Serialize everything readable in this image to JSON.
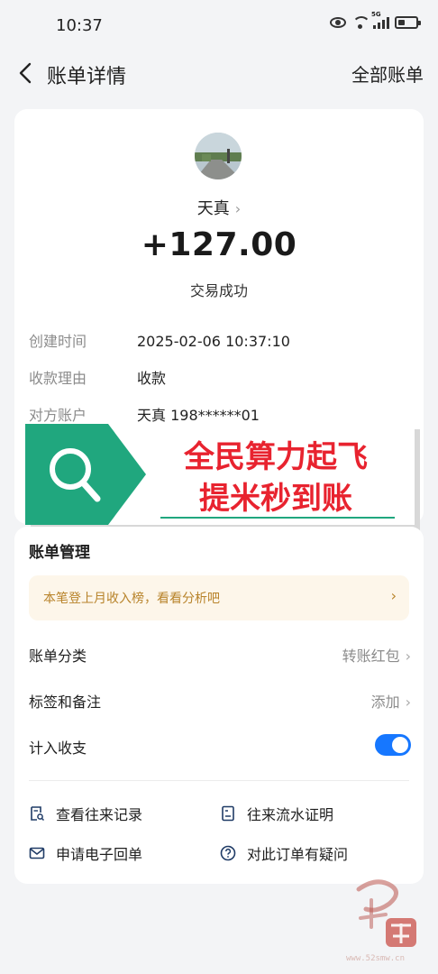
{
  "status_bar": {
    "time": "10:37",
    "network_label": "5G"
  },
  "nav": {
    "title": "账单详情",
    "right_action": "全部账单"
  },
  "transaction": {
    "payee": "天真",
    "amount": "+127.00",
    "status": "交易成功",
    "details": [
      {
        "label": "创建时间",
        "value": "2025-02-06 10:37:10"
      },
      {
        "label": "收款理由",
        "value": "收款"
      },
      {
        "label": "对方账户",
        "value": "天真 198******01"
      }
    ]
  },
  "overlay_banner": {
    "line1": "全民算力起飞",
    "line2": "提米秒到账"
  },
  "management": {
    "title": "账单管理",
    "tip": "本笔登上月收入榜，看看分析吧",
    "rows": [
      {
        "label": "账单分类",
        "value": "转账红包"
      },
      {
        "label": "标签和备注",
        "value": "添加"
      },
      {
        "label": "计入收支",
        "toggle_on": true
      }
    ],
    "links": [
      {
        "label": "查看往来记录",
        "icon": "record-search-icon"
      },
      {
        "label": "往来流水证明",
        "icon": "document-icon"
      },
      {
        "label": "申请电子回单",
        "icon": "mail-icon"
      },
      {
        "label": "对此订单有疑问",
        "icon": "question-icon"
      }
    ]
  },
  "watermark": {
    "url": "www.52smw.cn"
  },
  "colors": {
    "accent": "#1677ff",
    "banner_green": "#20a77e",
    "banner_red": "#e8232f",
    "tip_bg": "#fdf6ea",
    "tip_text": "#b8832a"
  }
}
